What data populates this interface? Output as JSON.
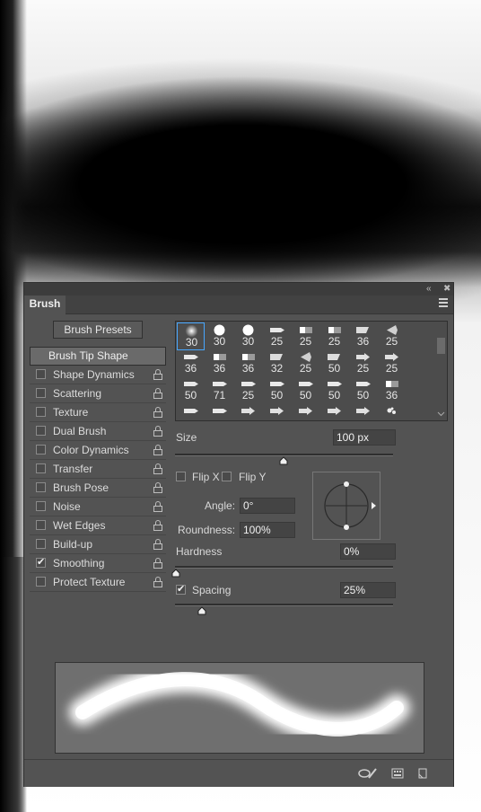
{
  "panel": {
    "tab_label": "Brush",
    "presets_button": "Brush Presets",
    "tip_shape_label": "Brush Tip Shape",
    "size_label": "Size",
    "size_value": "100 px",
    "flip_x": "Flip X",
    "flip_y": "Flip Y",
    "angle_label": "Angle:",
    "angle_value": "0°",
    "roundness_label": "Roundness:",
    "roundness_value": "100%",
    "hardness_label": "Hardness",
    "hardness_value": "0%",
    "spacing_label": "Spacing",
    "spacing_value": "25%",
    "spacing_checked": true,
    "size_slider_fraction": 0.5,
    "hardness_slider_fraction": 0.0,
    "spacing_slider_fraction": 0.12
  },
  "options": [
    {
      "label": "Shape Dynamics",
      "checked": false
    },
    {
      "label": "Scattering",
      "checked": false
    },
    {
      "label": "Texture",
      "checked": false
    },
    {
      "label": "Dual Brush",
      "checked": false
    },
    {
      "label": "Color Dynamics",
      "checked": false
    },
    {
      "label": "Transfer",
      "checked": false
    },
    {
      "label": "Brush Pose",
      "checked": false
    },
    {
      "label": "Noise",
      "checked": false
    },
    {
      "label": "Wet Edges",
      "checked": false
    },
    {
      "label": "Build-up",
      "checked": false
    },
    {
      "label": "Smoothing",
      "checked": true
    },
    {
      "label": "Protect Texture",
      "checked": false
    }
  ],
  "brush_tips": [
    {
      "size": "30",
      "icon": "soft-round-icon",
      "selected": true
    },
    {
      "size": "30",
      "icon": "hard-round-icon"
    },
    {
      "size": "30",
      "icon": "hard-round-icon"
    },
    {
      "size": "25",
      "icon": "pencil-tip-icon"
    },
    {
      "size": "25",
      "icon": "marker-tip-icon"
    },
    {
      "size": "25",
      "icon": "marker-tip-icon"
    },
    {
      "size": "36",
      "icon": "flat-tip-icon"
    },
    {
      "size": "25",
      "icon": "fan-tip-icon"
    },
    {
      "size": "36",
      "icon": "pencil-tip-icon"
    },
    {
      "size": "36",
      "icon": "marker-tip-icon"
    },
    {
      "size": "36",
      "icon": "marker-tip-icon"
    },
    {
      "size": "32",
      "icon": "flat-tip-icon"
    },
    {
      "size": "25",
      "icon": "fan-tip-icon"
    },
    {
      "size": "50",
      "icon": "flat-tip-icon"
    },
    {
      "size": "25",
      "icon": "arrow-tip-icon"
    },
    {
      "size": "25",
      "icon": "arrow-tip-icon"
    },
    {
      "size": "50",
      "icon": "pencil-tip-icon"
    },
    {
      "size": "71",
      "icon": "pencil-tip-icon"
    },
    {
      "size": "25",
      "icon": "pencil-tip-icon"
    },
    {
      "size": "50",
      "icon": "pencil-tip-icon"
    },
    {
      "size": "50",
      "icon": "pencil-tip-icon"
    },
    {
      "size": "50",
      "icon": "pencil-tip-icon"
    },
    {
      "size": "50",
      "icon": "pencil-tip-icon"
    },
    {
      "size": "36",
      "icon": "marker-tip-icon"
    },
    {
      "size": "",
      "icon": "pencil-tip-icon"
    },
    {
      "size": "",
      "icon": "pencil-tip-icon"
    },
    {
      "size": "",
      "icon": "arrow-tip-icon"
    },
    {
      "size": "",
      "icon": "arrow-tip-icon"
    },
    {
      "size": "",
      "icon": "arrow-tip-icon"
    },
    {
      "size": "",
      "icon": "arrow-tip-icon"
    },
    {
      "size": "",
      "icon": "arrow-tip-icon"
    },
    {
      "size": "",
      "icon": "splatter-tip-icon"
    }
  ]
}
